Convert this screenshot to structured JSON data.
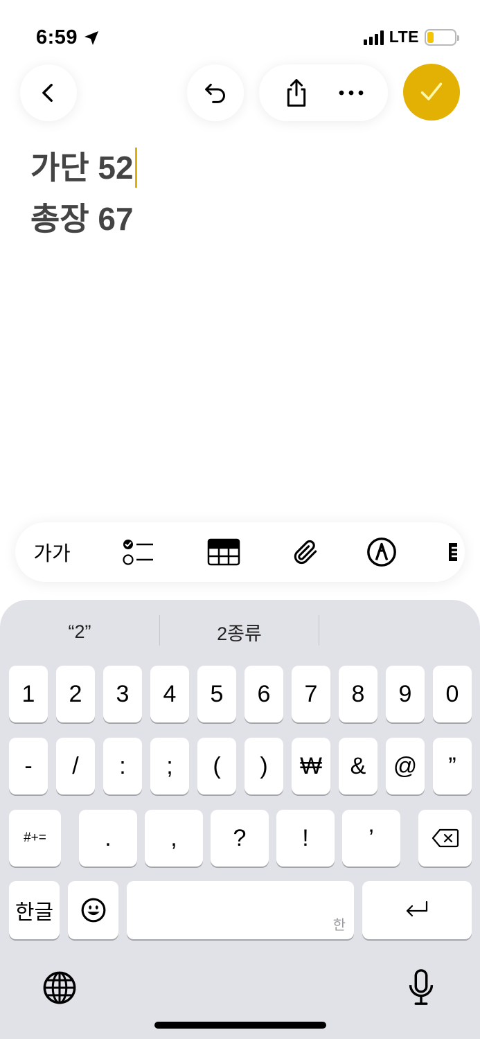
{
  "status_bar": {
    "time": "6:59",
    "network": "LTE",
    "battery_level": 0.2
  },
  "nav": {
    "back_icon": "chevron-left-icon",
    "undo_icon": "undo-icon",
    "share_icon": "share-icon",
    "more_icon": "ellipsis-icon",
    "done_icon": "checkmark-icon",
    "accent_color": "#e2b104"
  },
  "note": {
    "lines": [
      "가단 52",
      "총장 67"
    ]
  },
  "toolbar": {
    "format_label": "가가",
    "icons": [
      "checklist-icon",
      "table-icon",
      "paperclip-icon",
      "markup-pen-icon",
      "partial-cut-off-icon"
    ]
  },
  "keyboard": {
    "suggestions": [
      "“2”",
      "2종류",
      ""
    ],
    "row1": [
      "1",
      "2",
      "3",
      "4",
      "5",
      "6",
      "7",
      "8",
      "9",
      "0"
    ],
    "row2": [
      "-",
      "/",
      ":",
      ";",
      "(",
      ")",
      "₩",
      "&",
      "@",
      "”"
    ],
    "row3": {
      "mode_key": "#+=",
      "keys": [
        ".",
        ",",
        "?",
        "!",
        "’"
      ],
      "delete_icon": "backspace-icon"
    },
    "row4": {
      "lang_key": "한글",
      "emoji_icon": "emoji-icon",
      "space_hint": "한",
      "return_icon": "return-icon"
    },
    "globe_icon": "globe-icon",
    "mic_icon": "microphone-icon"
  }
}
